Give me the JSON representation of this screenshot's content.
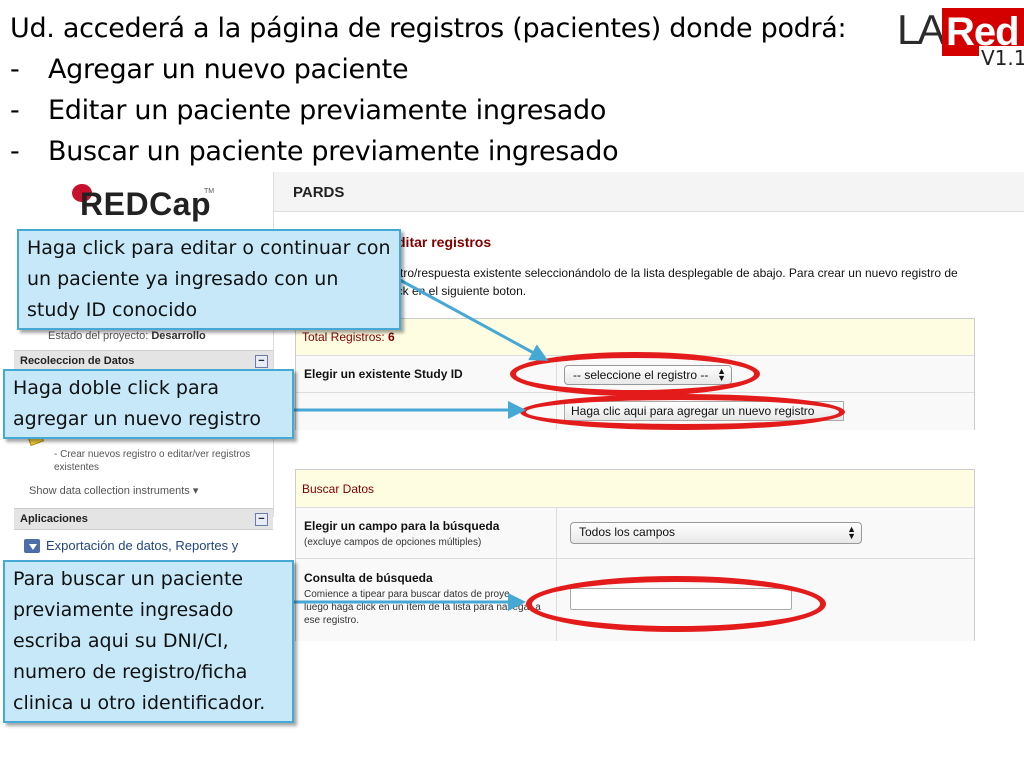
{
  "slide": {
    "intro": "Ud. accederá a la página de registros (pacientes) donde podrá:",
    "bullets": [
      "Agregar un nuevo paciente",
      "Editar un paciente previamente ingresado",
      "Buscar un paciente previamente ingresado"
    ],
    "bullet_marker": "-"
  },
  "logo": {
    "la": "LA",
    "red": "Red",
    "version": "V1.1"
  },
  "redcap": {
    "logo_text": "REDCap",
    "tm": "TM",
    "project_header": "PARDS",
    "status_label": "Estado del proyecto:",
    "status_value": "Desarrollo",
    "sections": {
      "data_collection": "Recoleccion de Datos",
      "applications": "Aplicaciones"
    },
    "toggle_symbol": "−",
    "item_sub": "- Crear nuevos registro o editar/ver registros existentes",
    "show_instruments": "Show data collection instruments ▾",
    "export_link": "Exportación de datos, Reportes y",
    "page_heading": "ditar registros",
    "page_desc_line1": "stro/respuesta existente seleccionándolo de la lista desplegable de abajo. Para crear un nuevo registro de",
    "page_desc_line2": "ick en el siguiente boton.",
    "records_panel": {
      "total_label": "Total Registros:",
      "total_value": "6",
      "choose_label": "Elegir un existente Study ID",
      "select_value": "-- seleccione el registro --",
      "add_button": "Haga clic aqui para agregar un nuevo registro"
    },
    "search_panel": {
      "title": "Buscar Datos",
      "field_label": "Elegir un campo para la búsqueda",
      "field_sub": "(excluye campos de opciones múltiples)",
      "field_select": "Todos los campos",
      "query_label": "Consulta de búsqueda",
      "query_sub_line1": "Comience a tipear para buscar datos de proye",
      "query_sub_line2": "luego haga click en un ítem de la lista para navegar a",
      "query_sub_line3": "ese registro.",
      "query_value": ""
    }
  },
  "callouts": {
    "edit": "Haga click para editar o continuar con un paciente ya ingresado con un study ID conocido",
    "add": "Haga doble click para agregar un nuevo registro",
    "search": "Para buscar un paciente previamente ingresado escriba aqui su DNI/CI, numero de registro/ficha clinica u otro identificador."
  },
  "colors": {
    "callout_bg": "#c6e8f8",
    "callout_border": "#46a8d4",
    "highlight": "#e41b1b",
    "heading": "#800000",
    "panel_head": "#fefde2",
    "logo_red": "#d40000"
  }
}
